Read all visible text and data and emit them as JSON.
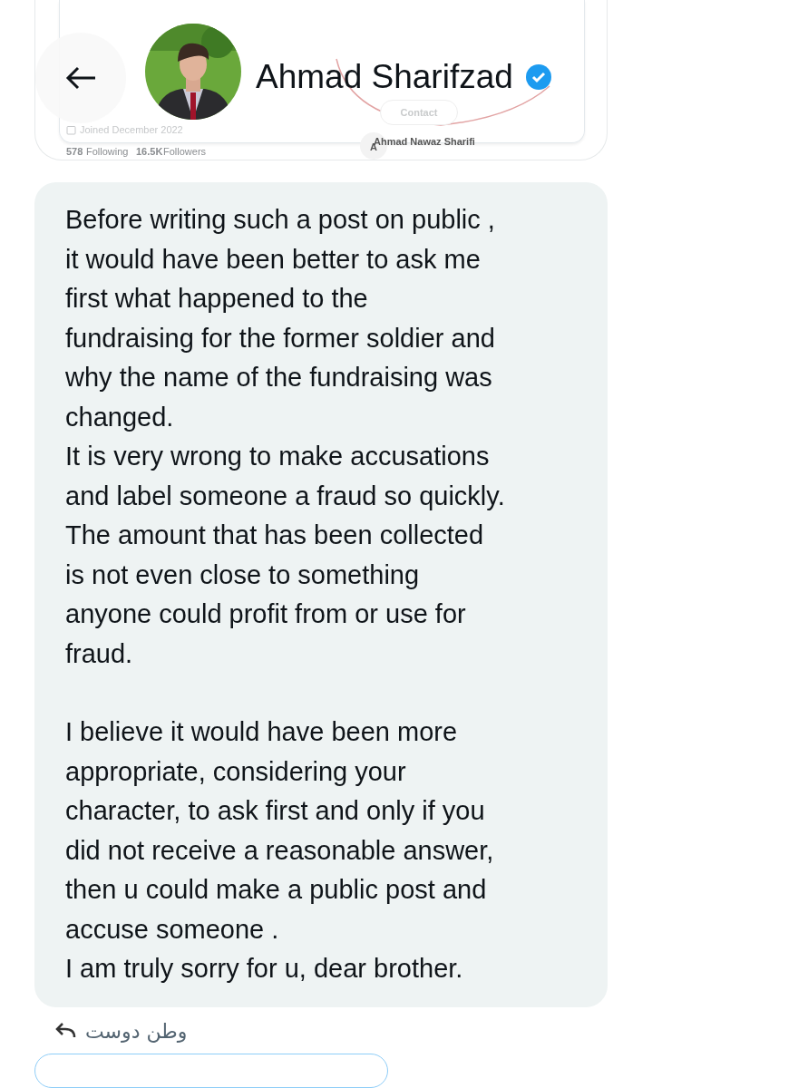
{
  "quoted_profile": {
    "joined": "Joined December 2022",
    "following_count": "578",
    "following_label": "Following",
    "followers_count": "16.5K",
    "followers_label": "Followers",
    "contact_button": "Contact",
    "mention_initial": "A",
    "mention_name": "Ahmad Nawaz Sharifi"
  },
  "header": {
    "name": "Ahmad Sharifzad",
    "verified": true
  },
  "message": {
    "blocks": [
      {
        "lines": [
          "Before writing such a post on public ,",
          "it would have been better to ask me",
          "first what happened to the",
          "fundraising for the former soldier and",
          "why the name of the fundraising was",
          "changed.",
          "It is very wrong to make accusations",
          "and label someone a fraud so quickly.",
          "The amount that has been collected",
          "is not even close to something",
          "anyone could profit from or use for",
          "fraud."
        ]
      },
      {
        "lines": [
          "I believe it would have been more",
          "appropriate, considering your",
          "character, to ask first and only if you",
          "did not receive a reasonable answer,",
          "then u could make a public post and",
          "accuse someone .",
          "I am truly sorry for u, dear brother."
        ]
      }
    ]
  },
  "reply_author": "وطن دوست"
}
